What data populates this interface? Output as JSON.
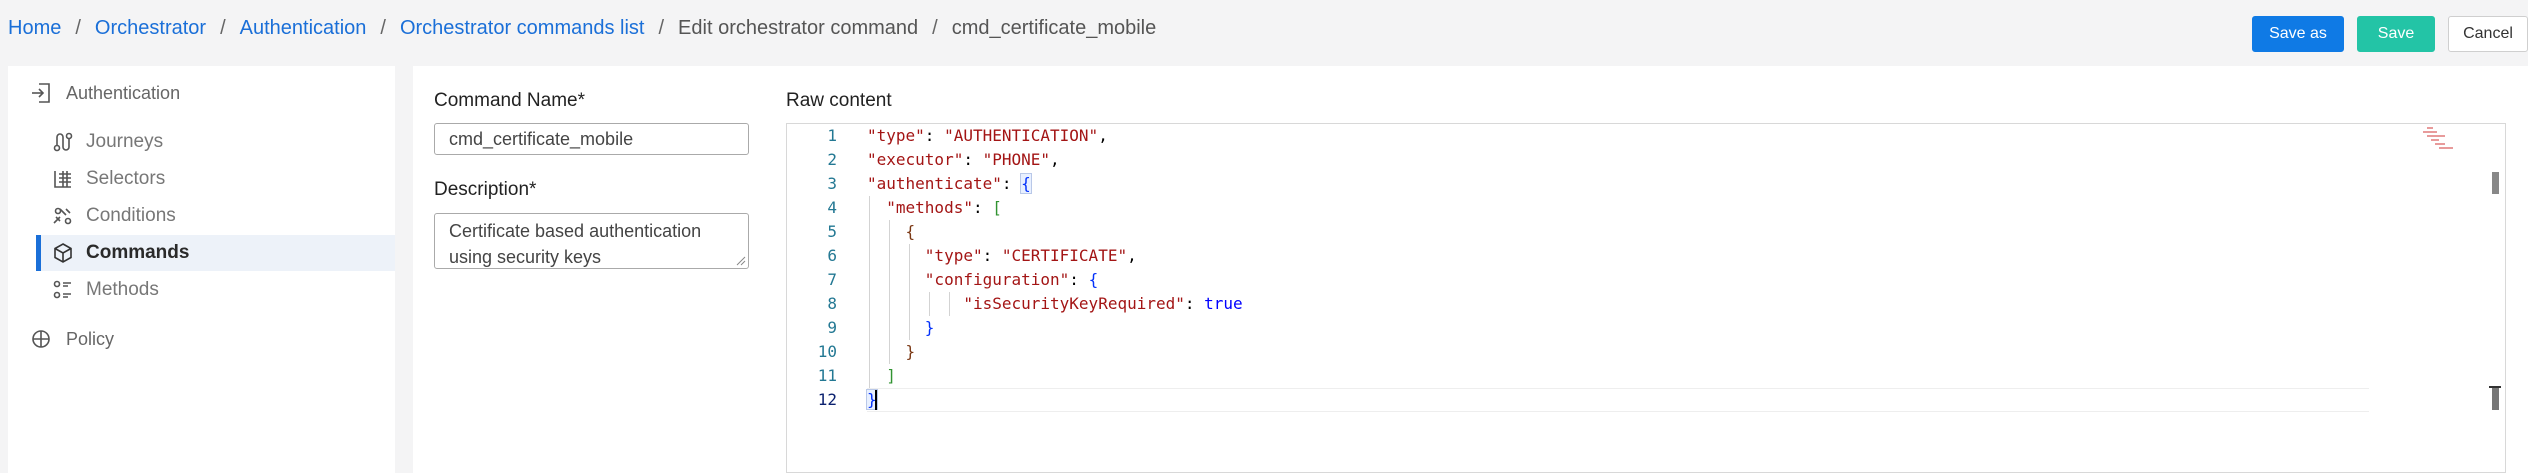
{
  "breadcrumb": {
    "items": [
      "Home",
      "Orchestrator",
      "Authentication",
      "Orchestrator commands list"
    ],
    "current": [
      "Edit orchestrator command",
      "cmd_certificate_mobile"
    ],
    "separator": "/"
  },
  "actions": {
    "save_as": "Save as",
    "save": "Save",
    "cancel": "Cancel"
  },
  "sidebar": {
    "groups": [
      {
        "label": "Authentication",
        "icon": "login-icon"
      },
      {
        "label": "Policy",
        "icon": "policy-icon"
      }
    ],
    "items": [
      {
        "label": "Journeys",
        "icon": "journeys-icon",
        "active": false
      },
      {
        "label": "Selectors",
        "icon": "selectors-icon",
        "active": false
      },
      {
        "label": "Conditions",
        "icon": "conditions-icon",
        "active": false
      },
      {
        "label": "Commands",
        "icon": "cube-icon",
        "active": true
      },
      {
        "label": "Methods",
        "icon": "methods-icon",
        "active": false
      }
    ]
  },
  "form": {
    "command_name_label": "Command Name*",
    "command_name_value": "cmd_certificate_mobile",
    "description_label": "Description*",
    "description_value": "Certificate based authentication using security keys",
    "raw_content_label": "Raw content"
  },
  "editor": {
    "line_numbers": [
      "1",
      "2",
      "3",
      "4",
      "5",
      "6",
      "7",
      "8",
      "9",
      "10",
      "11",
      "12"
    ],
    "current_line": 12,
    "tokens": {
      "l1_key": "\"type\"",
      "l1_val": "\"AUTHENTICATION\"",
      "l2_key": "\"executor\"",
      "l2_val": "\"PHONE\"",
      "l3_key": "\"authenticate\"",
      "l3_open": "{",
      "l4_key": "\"methods\"",
      "l4_open": "[",
      "l5_open": "{",
      "l6_key": "\"type\"",
      "l6_val": "\"CERTIFICATE\"",
      "l7_key": "\"configuration\"",
      "l7_open": "{",
      "l8_key": "\"isSecurityKeyRequired\"",
      "l8_val": "true",
      "l9_close": "}",
      "l10_close": "}",
      "l11_close": "]",
      "l12_close": "}"
    }
  },
  "colors": {
    "link": "#1a6fd8",
    "primary": "#0f7ae5",
    "success": "#23c4a6"
  }
}
